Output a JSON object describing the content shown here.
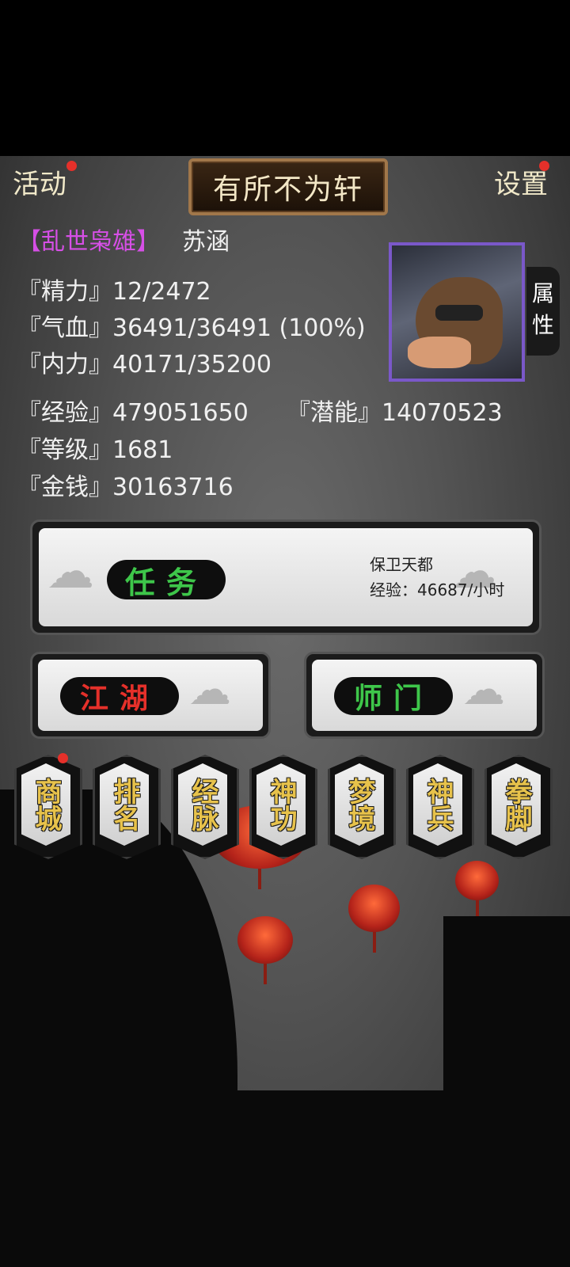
{
  "top_bar": {
    "activity_label": "活动",
    "title": "有所不为轩",
    "settings_label": "设置"
  },
  "profile": {
    "title_tag": "【乱世枭雄】",
    "name": "苏涵",
    "attribute_tab": "属性"
  },
  "stats": {
    "energy": "『精力』12/2472",
    "hp": "『气血』36491/36491 (100%)",
    "mp": "『内力』40171/35200",
    "exp": "『经验』479051650",
    "potential": "『潜能』14070523",
    "level": "『等级』1681",
    "money": "『金钱』30163716"
  },
  "quest": {
    "button_label": "任务",
    "info_title": "保卫天都",
    "info_rate": "经验：46687/小时"
  },
  "jianghu_label": "江湖",
  "sect_label": "师门",
  "menu_tiles": [
    {
      "label": "商城"
    },
    {
      "label": "排名"
    },
    {
      "label": "经脉"
    },
    {
      "label": "神功"
    },
    {
      "label": "梦境"
    },
    {
      "label": "神兵"
    },
    {
      "label": "拳脚"
    }
  ],
  "colors": {
    "title_tag": "#d64fe6",
    "quest_text": "#3ec64a",
    "jianghu_text": "#e5302a",
    "sect_text": "#3ec64a",
    "tile_text": "#e7c24b",
    "notification_dot": "#e5302a"
  }
}
